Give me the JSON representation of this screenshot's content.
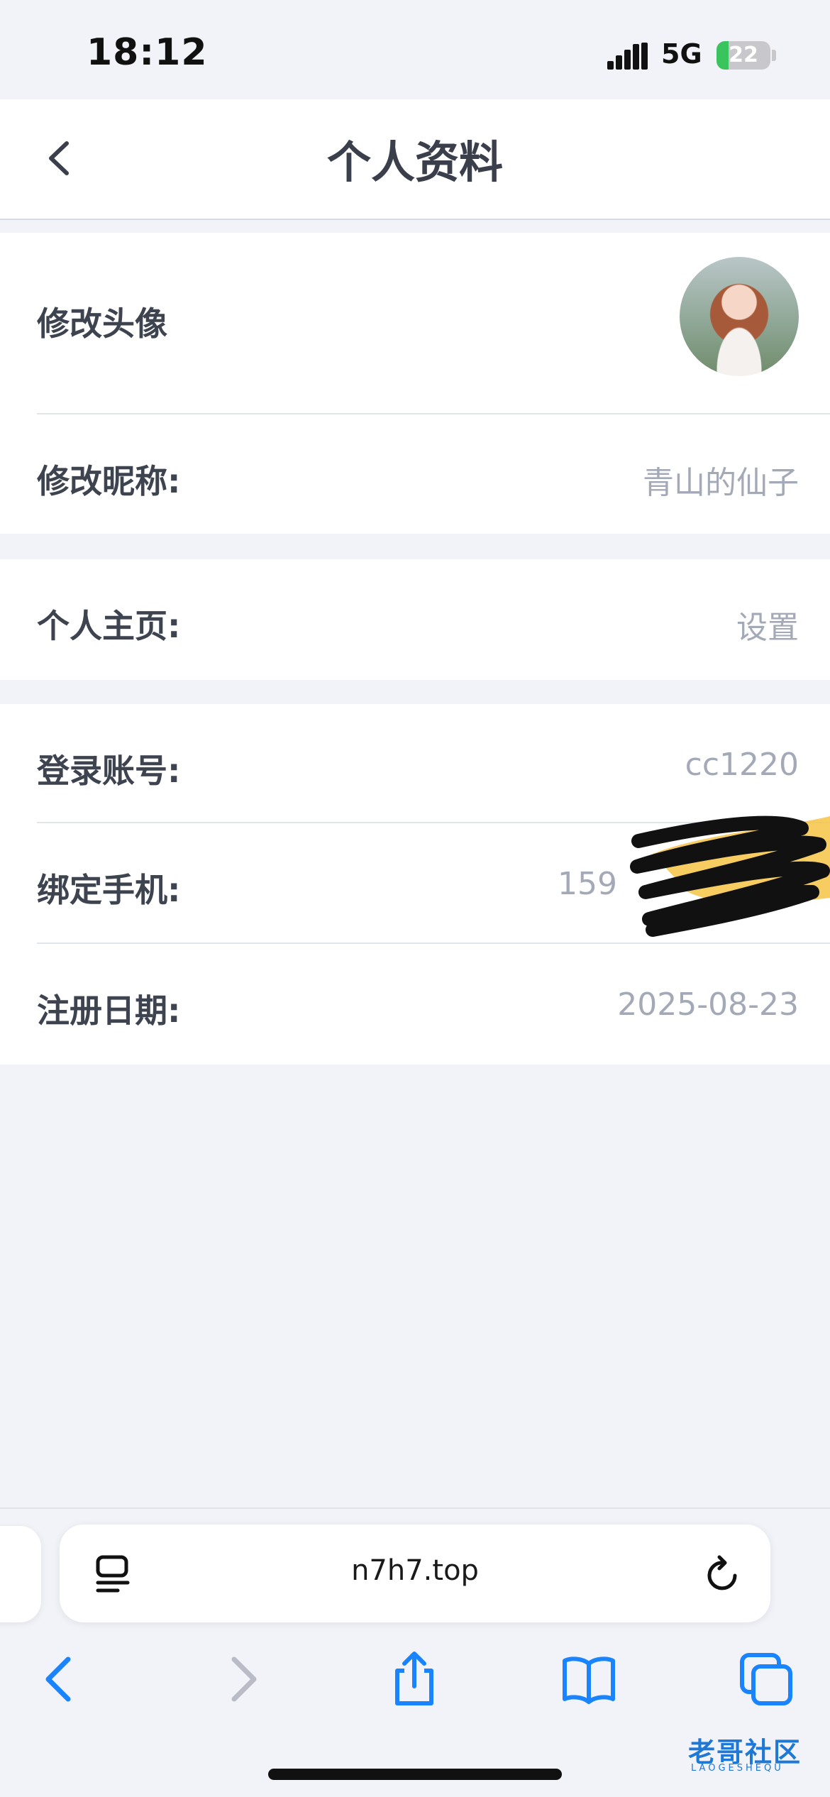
{
  "status_bar": {
    "time": "18:12",
    "network": "5G",
    "battery_level": "22",
    "battery_color": "#3ac45e"
  },
  "header": {
    "title": "个人资料",
    "back_icon": "chevron-left-icon"
  },
  "profile": {
    "avatar_label": "修改头像",
    "nickname_label": "修改昵称:",
    "nickname_value": "青山的仙子"
  },
  "homepage": {
    "label": "个人主页:",
    "value": "设置"
  },
  "account": {
    "login_label": "登录账号:",
    "login_value": "cc1220",
    "phone_label": "绑定手机:",
    "phone_value": "159",
    "register_label": "注册日期:",
    "register_value": "2025-08-23"
  },
  "browser": {
    "url": "n7h7.top",
    "page_menu_icon": "page-menu-icon",
    "reload_icon": "reload-icon",
    "toolbar": [
      "back-icon",
      "forward-icon",
      "share-icon",
      "bookmarks-icon",
      "tabs-icon"
    ],
    "accent_color": "#1a84ff"
  },
  "watermark": {
    "text": "老哥社区",
    "subtext": "LAOGESHEQU"
  }
}
